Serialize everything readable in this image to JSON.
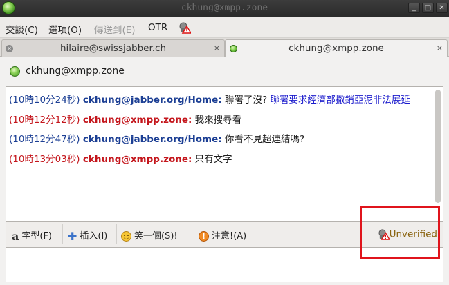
{
  "window": {
    "title": "ckhung@xmpp.zone",
    "buttons": {
      "minimize": "_",
      "maximize": "□",
      "close": "✕"
    }
  },
  "menu": {
    "items": [
      "交談(C)",
      "選項(O)",
      "傳送到(E)",
      "OTR"
    ],
    "disabled_index": 2
  },
  "tabs": [
    {
      "label": "hilaire@swissjabber.ch",
      "active": false,
      "close": "×"
    },
    {
      "label": "ckhung@xmpp.zone",
      "active": true,
      "close": "×"
    }
  ],
  "conversation": {
    "contact": "ckhung@xmpp.zone",
    "status_color": "#5fb832",
    "messages": [
      {
        "time": "(10時10分24秒)",
        "sender": "ckhung@jabber.org/Home:",
        "text": " 聯署了沒? ",
        "link": "聯署要求經濟部撤銷亞泥非法展延",
        "color": "blue"
      },
      {
        "time": "(10時12分12秒)",
        "sender": "ckhung@xmpp.zone:",
        "text": " 我來搜尋看",
        "color": "red"
      },
      {
        "time": "(10時12分47秒)",
        "sender": "ckhung@jabber.org/Home:",
        "text": " 你看不見超連結嗎?",
        "color": "blue"
      },
      {
        "time": "(10時13分03秒)",
        "sender": "ckhung@xmpp.zone:",
        "text": " 只有文字",
        "color": "red"
      }
    ]
  },
  "toolbar": {
    "font_label": "字型(F)",
    "insert_label": "插入(I)",
    "smile_label": "笑一個(S)!",
    "attention_label": "注意!(A)",
    "otr_status": "Unverified"
  },
  "colors": {
    "highlight_box": "#e0141c",
    "incoming": "#1c3f94",
    "outgoing": "#c4161c",
    "link": "#1a1acc",
    "unverified_text": "#8a6410"
  }
}
